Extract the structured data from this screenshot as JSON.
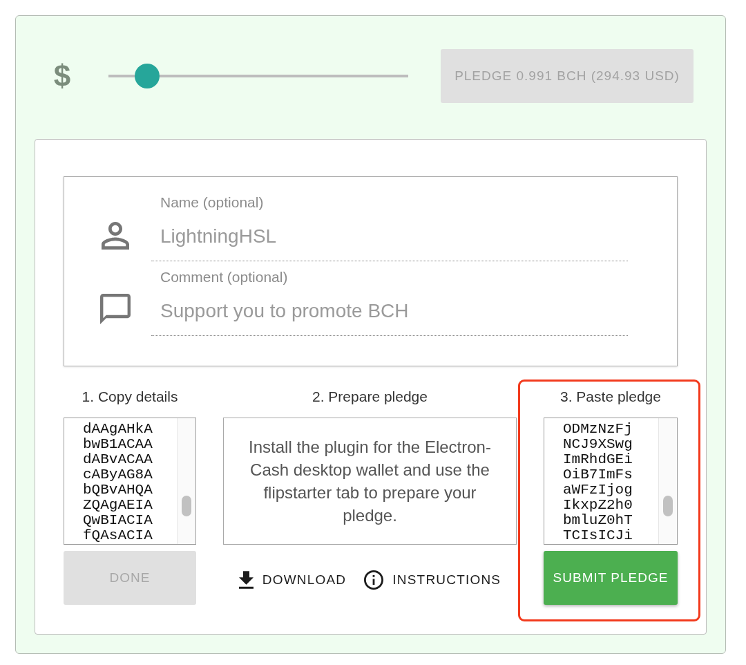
{
  "amount_slider": {
    "currency_symbol": "$",
    "level": 0.13
  },
  "pledge_button": {
    "label": "PLEDGE 0.991 BCH (294.93 USD)",
    "disabled": true
  },
  "form": {
    "fields": [
      {
        "kind": "name",
        "label": "Name (optional)",
        "value": "LightningHSL"
      },
      {
        "kind": "comment",
        "label": "Comment (optional)",
        "value": "Support you to promote BCH"
      }
    ]
  },
  "steps": [
    {
      "kind": "textarea",
      "title": "1. Copy details",
      "highlighted": false,
      "lines": [
        "dAAgAHkA",
        "bwB1ACAA",
        "dABvACAA",
        "cAByAG8A",
        "bQBvAHQA",
        "ZQAgAEIA",
        "QwBIACIA",
        "fQAsACIA"
      ],
      "button": {
        "label": "DONE",
        "disabled": true
      }
    },
    {
      "kind": "info",
      "title": "2. Prepare pledge",
      "highlighted": false,
      "text": "Install the plugin for the Electron-Cash desktop wallet and use the flipstarter tab to prepare your pledge.",
      "actions": [
        {
          "kind": "download",
          "label": "DOWNLOAD"
        },
        {
          "kind": "info",
          "label": "INSTRUCTIONS"
        }
      ]
    },
    {
      "kind": "textarea",
      "title": "3. Paste pledge",
      "highlighted": true,
      "lines": [
        "ODMzNzFj",
        "NCJ9XSwg",
        "ImRhdGEi",
        "OiB7ImFs",
        "aWFzIjog",
        "IkxpZ2h0",
        "bmluZ0hT",
        "TCIsICJi"
      ],
      "button": {
        "label": "SUBMIT PLEDGE",
        "disabled": false
      }
    }
  ]
}
